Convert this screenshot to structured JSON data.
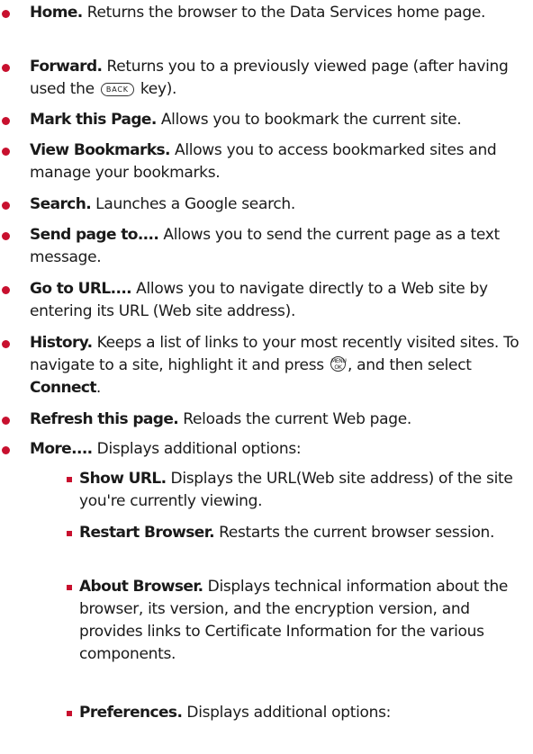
{
  "colors": {
    "bullet": "#c8102e",
    "sub_bullet": "#c8102e",
    "text": "#1a1a1a"
  },
  "items": [
    {
      "term": "Home.",
      "desc1": " Returns the browser to the Data Services home page."
    },
    {
      "term": "Forward.",
      "desc1": " Returns you to a previously viewed page (after having used the",
      "key_label": "BACK",
      "desc2": " key)."
    },
    {
      "term": "Mark this Page.",
      "desc1": " Allows you to bookmark the current site."
    },
    {
      "term": "View Bookmarks.",
      "desc1": " Allows you to access bookmarked sites and manage your bookmarks."
    },
    {
      "term": "Search.",
      "desc1": " Launches a Google search."
    },
    {
      "term": "Send page to....",
      "desc1": " Allows you to send the current page as a text message."
    },
    {
      "term": "Go to URL....",
      "desc1": " Allows you to navigate directly to a Web site by entering its URL (Web site address)."
    },
    {
      "term": "History.",
      "desc1": " Keeps a list of links to your most recently visited sites. To navigate to a site, highlight it and press",
      "key_top": "MENU",
      "key_bottom": "OK",
      "desc2": ", and then select ",
      "term2": "Connect",
      "desc3": "."
    },
    {
      "term": "Refresh this page.",
      "desc1": " Reloads the current Web page."
    },
    {
      "term": "More....",
      "desc1": " Displays additional options:"
    }
  ],
  "subitems": [
    {
      "term": "Show URL.",
      "desc": " Displays the URL(Web site address) of the site you're currently viewing."
    },
    {
      "term": "Restart Browser.",
      "desc": " Restarts the current browser session."
    },
    {
      "term": "About Browser.",
      "desc": "  Displays technical information about the browser, its version, and the encryption version, and provides links to Certificate Information for the various components."
    },
    {
      "term": "Preferences.",
      "desc": " Displays additional options:"
    }
  ]
}
